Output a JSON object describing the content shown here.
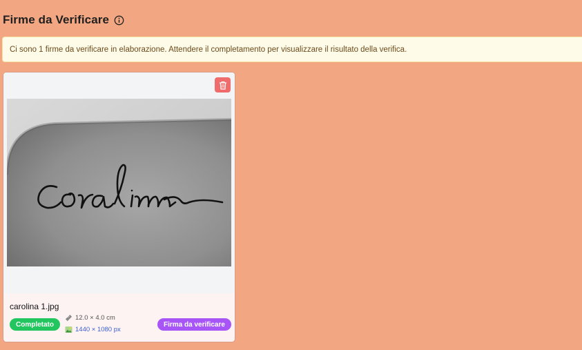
{
  "page": {
    "title": "Firme da Verificare",
    "info_icon": "info-circle-icon"
  },
  "alert": {
    "message": "Ci sono 1 firme da verificare in elaborazione. Attendere il completamento per visualizzare il risultato della verifica."
  },
  "cards": [
    {
      "filename": "carolina 1.jpg",
      "status": "Completato",
      "dimensions": "12.0 × 4.0 cm",
      "dimensions_icon": "ruler-icon",
      "pixels": "1440 × 1080 px",
      "pixels_icon": "image-icon",
      "type_label": "Firma da verificare",
      "delete_icon": "trash-icon",
      "image_alt": "carolina"
    }
  ],
  "colors": {
    "background": "#f2a782",
    "status_completed": "#22c55e",
    "type_badge": "#a855f7",
    "delete_button": "#f06b6b",
    "alert_bg": "#fefbe8"
  }
}
